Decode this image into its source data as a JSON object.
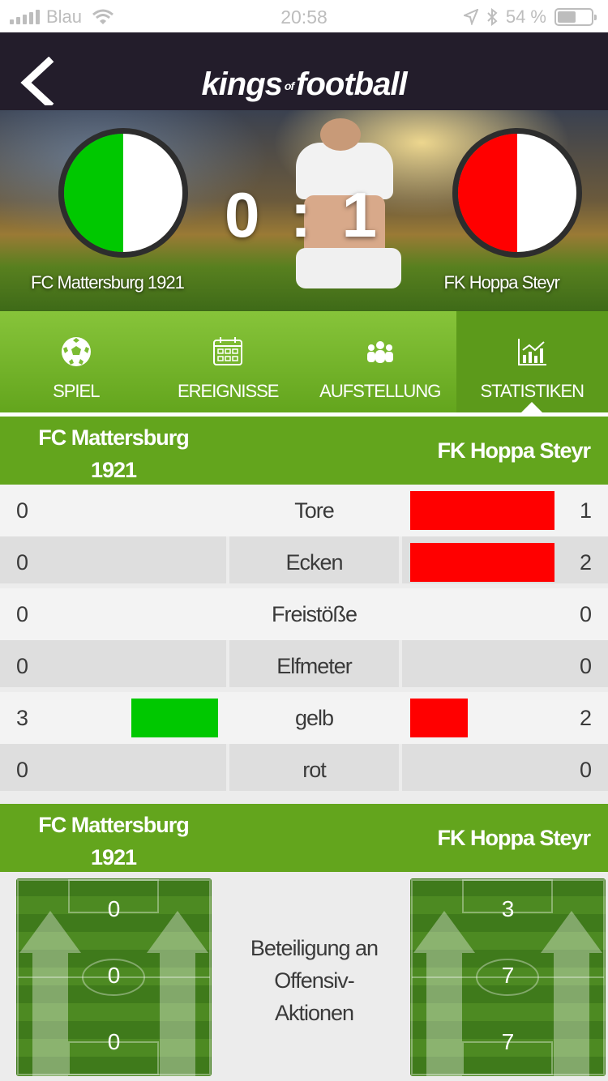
{
  "status_bar": {
    "carrier": "Blau",
    "time": "20:58",
    "battery": "54 %",
    "battery_level": 0.54
  },
  "header": {
    "logo_kings": "kings",
    "logo_of": "of",
    "logo_football": "football"
  },
  "match": {
    "home_team": "FC Mattersburg 1921",
    "away_team": "FK Hoppa Steyr",
    "home_score": "0",
    "separator": ":",
    "away_score": "1",
    "home_colors": [
      "#00c800",
      "#ffffff"
    ],
    "away_colors": [
      "#ff0000",
      "#ffffff"
    ]
  },
  "tabs": [
    {
      "label": "SPIEL",
      "icon": "soccer-ball-icon",
      "active": false
    },
    {
      "label": "EREIGNISSE",
      "icon": "calendar-icon",
      "active": false
    },
    {
      "label": "AUFSTELLUNG",
      "icon": "team-icon",
      "active": false
    },
    {
      "label": "STATISTIKEN",
      "icon": "chart-icon",
      "active": true
    }
  ],
  "team_header": {
    "home_line1": "FC Mattersburg",
    "home_line2": "1921",
    "away": "FK Hoppa Steyr"
  },
  "stats": [
    {
      "label": "Tore",
      "home": "0",
      "away": "1"
    },
    {
      "label": "Ecken",
      "home": "0",
      "away": "2"
    },
    {
      "label": "Freistöße",
      "home": "0",
      "away": "0"
    },
    {
      "label": "Elfmeter",
      "home": "0",
      "away": "0"
    },
    {
      "label": "gelb",
      "home": "3",
      "away": "2"
    },
    {
      "label": "rot",
      "home": "0",
      "away": "0"
    }
  ],
  "colors": {
    "home_bar": "#00c800",
    "away_bar": "#ff0000",
    "accent_green": "#63a51d"
  },
  "offense": {
    "label_line1": "Beteiligung an",
    "label_line2": "Offensiv-",
    "label_line3": "Aktionen",
    "home_values": [
      "0",
      "0",
      "0"
    ],
    "away_values": [
      "3",
      "7",
      "7"
    ]
  }
}
